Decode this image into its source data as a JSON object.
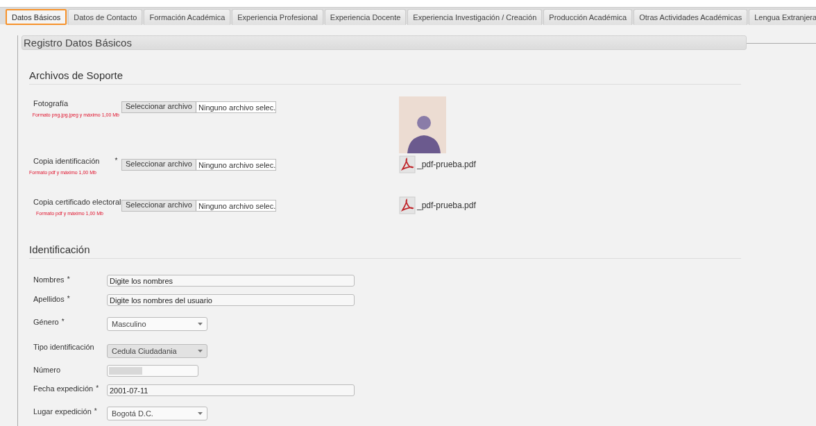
{
  "tabs": [
    {
      "label": "Datos Básicos",
      "selected": true
    },
    {
      "label": "Datos de Contacto",
      "selected": false
    },
    {
      "label": "Formación Académica",
      "selected": false
    },
    {
      "label": "Experiencia Profesional",
      "selected": false
    },
    {
      "label": "Experiencia Docente",
      "selected": false
    },
    {
      "label": "Experiencia Investigación / Creación",
      "selected": false
    },
    {
      "label": "Producción Académica",
      "selected": false
    },
    {
      "label": "Otras Actividades Académicas",
      "selected": false
    },
    {
      "label": "Lengua Extranjera",
      "selected": false
    }
  ],
  "panel_title": "Registro Datos Básicos",
  "support_files": {
    "title": "Archivos de Soporte",
    "rows": [
      {
        "label": "Fotografía",
        "button": "Seleccionar archivo",
        "status": "Ninguno archivo selec.",
        "hint": "Formato png.jpg.jpeg y máximo 1,00 Mb",
        "preview": {
          "kind": "photo"
        }
      },
      {
        "label": "Copia identificación",
        "marker": "*",
        "button": "Seleccionar archivo",
        "status": "Ninguno archivo selec.",
        "hint": "Formato pdf y máximo 1,00 Mb",
        "preview": {
          "kind": "pdf",
          "name": "_pdf-prueba.pdf"
        }
      },
      {
        "label": "Copia certificado electoral",
        "button": "Seleccionar archivo",
        "status": "Ninguno archivo selec.",
        "hint": "Formato pdf y máximo 1,00 Mb",
        "preview": {
          "kind": "pdf",
          "name": "_pdf-prueba.pdf"
        }
      }
    ]
  },
  "identification": {
    "title": "Identificación",
    "fields": [
      {
        "label": "Nombres",
        "marker": "*",
        "kind": "text",
        "value": "Digite los nombres"
      },
      {
        "label": "Apellidos",
        "marker": "*",
        "kind": "text",
        "value": "Digite los nombres del usuario"
      },
      {
        "label": "Género",
        "marker": "*",
        "kind": "select",
        "value": "Masculino",
        "disabled": false
      },
      {
        "label": "Tipo identificación",
        "kind": "select",
        "value": "Cedula Ciudadania",
        "disabled": true
      },
      {
        "label": "Número",
        "kind": "redacted"
      },
      {
        "label": "Fecha expedición",
        "marker": "*",
        "kind": "text",
        "value": "2001-07-11"
      },
      {
        "label": "Lugar expedición",
        "marker": "*",
        "kind": "select",
        "value": "Bogotá D.C.",
        "disabled": false
      }
    ]
  }
}
